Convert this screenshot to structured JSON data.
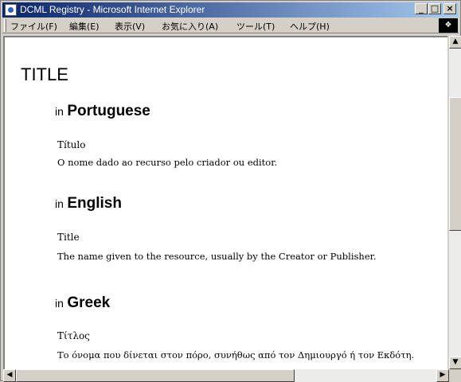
{
  "window": {
    "title": "DCML Registry - Microsoft Internet Explorer",
    "minimize_glyph": "_",
    "maximize_glyph": "□",
    "close_glyph": "×"
  },
  "menu": {
    "items": [
      {
        "label": "ファイル(F)"
      },
      {
        "label": "編集(E)"
      },
      {
        "label": "表示(V)"
      },
      {
        "label": "お気に入り(A)"
      },
      {
        "label": "ツール(T)"
      },
      {
        "label": "ヘルプ(H)"
      }
    ]
  },
  "page": {
    "title": "TITLE",
    "in_word": "in",
    "sections": [
      {
        "language": "Portuguese",
        "term": "Título",
        "definition": "O nome dado ao recurso pelo criador ou editor."
      },
      {
        "language": "English",
        "term": "Title",
        "definition": "The name given to the resource, usually by the Creator or Publisher."
      },
      {
        "language": "Greek",
        "term": "Τίτλος",
        "definition": "Το όνομα που δίνεται στον πόρο, συνήθως από τον Δημιουργό ή τον Εκδότη."
      }
    ]
  },
  "scrollbar": {
    "up_glyph": "▲",
    "down_glyph": "▼",
    "left_glyph": "◀",
    "right_glyph": "▶"
  },
  "icons": {
    "app": "ie-page-icon",
    "throbber": "ie-logo-icon"
  }
}
